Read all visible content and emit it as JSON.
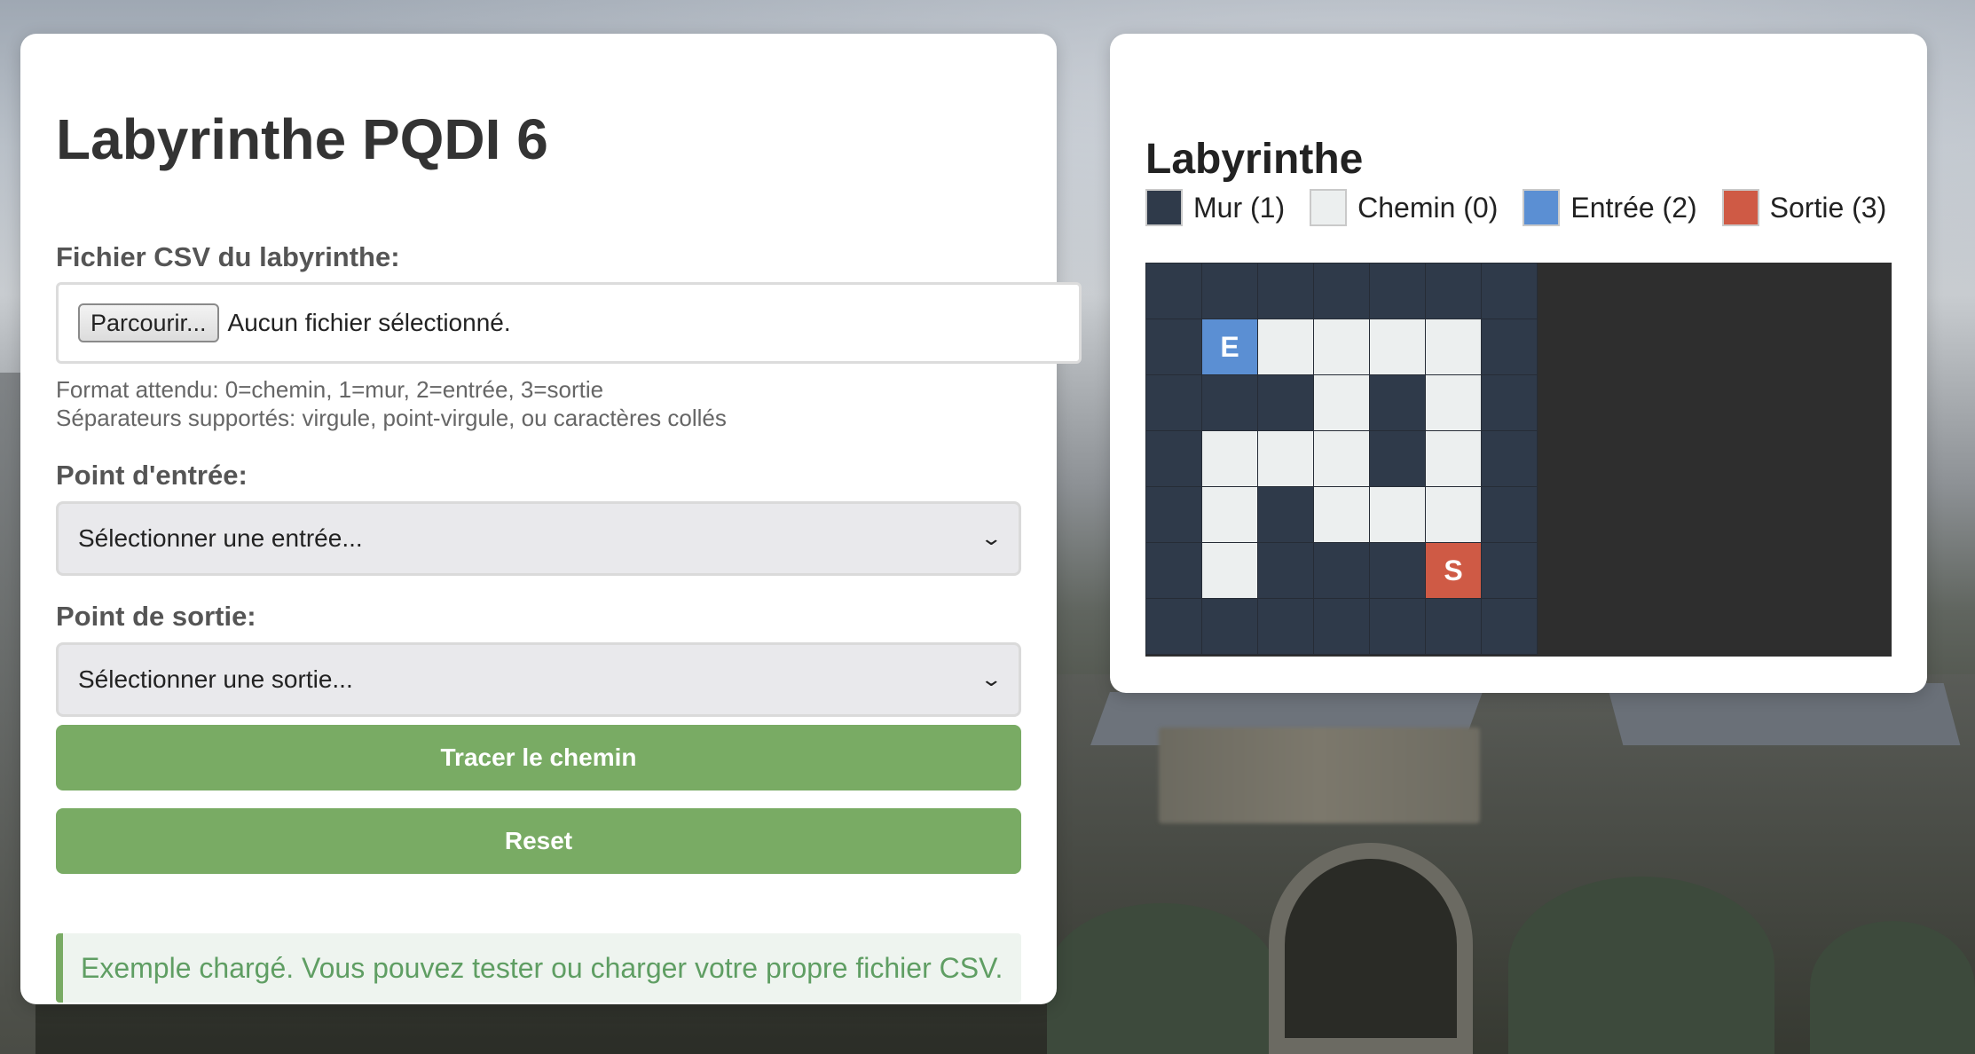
{
  "left_panel": {
    "title": "Labyrinthe PQDI 6",
    "file_label": "Fichier CSV du labyrinthe:",
    "file_button": "Parcourir...",
    "file_status": "Aucun fichier sélectionné.",
    "format_hint": "Format attendu: 0=chemin, 1=mur, 2=entrée, 3=sortie",
    "separator_hint": "Séparateurs supportés: virgule, point-virgule, ou caractères collés",
    "entry_label": "Point d'entrée:",
    "entry_select": "Sélectionner une entrée...",
    "exit_label": "Point de sortie:",
    "exit_select": "Sélectionner une sortie...",
    "trace_button": "Tracer le chemin",
    "reset_button": "Reset",
    "status_message": "Exemple chargé. Vous pouvez tester ou charger votre propre fichier CSV."
  },
  "right_panel": {
    "title": "Labyrinthe",
    "legend": [
      {
        "label": "Mur (1)",
        "color": "#2f3a4a"
      },
      {
        "label": "Chemin (0)",
        "color": "#ecefef"
      },
      {
        "label": "Entrée (2)",
        "color": "#5b8fd3"
      },
      {
        "label": "Sortie (3)",
        "color": "#cf5a45"
      }
    ],
    "maze": [
      [
        1,
        1,
        1,
        1,
        1,
        1,
        1
      ],
      [
        1,
        2,
        0,
        0,
        0,
        0,
        1
      ],
      [
        1,
        1,
        1,
        0,
        1,
        0,
        1
      ],
      [
        1,
        0,
        0,
        0,
        1,
        0,
        1
      ],
      [
        1,
        0,
        1,
        0,
        0,
        0,
        1
      ],
      [
        1,
        0,
        1,
        1,
        1,
        3,
        1
      ],
      [
        1,
        1,
        1,
        1,
        1,
        1,
        1
      ]
    ],
    "entry_marker": "E",
    "exit_marker": "S"
  },
  "colors": {
    "accent_green": "#79ab64",
    "status_text": "#5f9e63",
    "wall": "#2f3a4a",
    "path": "#ecefef",
    "entry": "#5b8fd3",
    "exit": "#cf5a45"
  }
}
